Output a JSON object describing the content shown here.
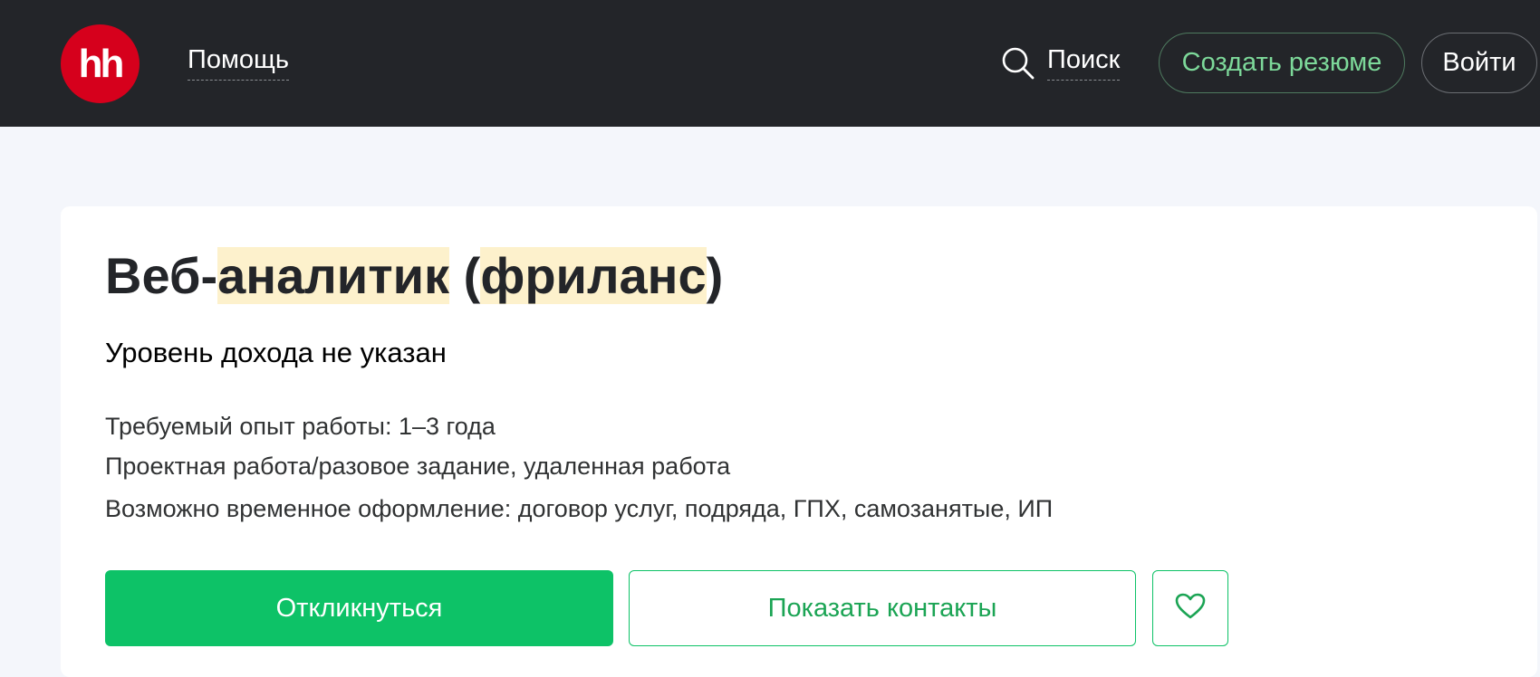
{
  "header": {
    "logo_text": "hh",
    "nav_help": "Помощь",
    "search_label": "Поиск",
    "create_resume": "Создать резюме",
    "login": "Войти"
  },
  "vacancy": {
    "title_prefix": "Веб-",
    "title_hl1": "аналитик",
    "title_mid": " (",
    "title_hl2": "фриланс",
    "title_suffix": ")",
    "salary": "Уровень дохода не указан",
    "experience": "Требуемый опыт работы: 1–3 года",
    "employment": "Проектная работа/разовое задание, удаленная работа",
    "contract": "Возможно временное оформление: договор услуг, подряда, ГПХ, самозанятые, ИП"
  },
  "actions": {
    "apply": "Откликнуться",
    "show_contacts": "Показать контакты",
    "favorite_icon": "heart-icon"
  },
  "colors": {
    "header_bg": "#232529",
    "logo_red": "#d6001c",
    "accent_green": "#0dc267",
    "highlight": "#fdf1cc"
  }
}
